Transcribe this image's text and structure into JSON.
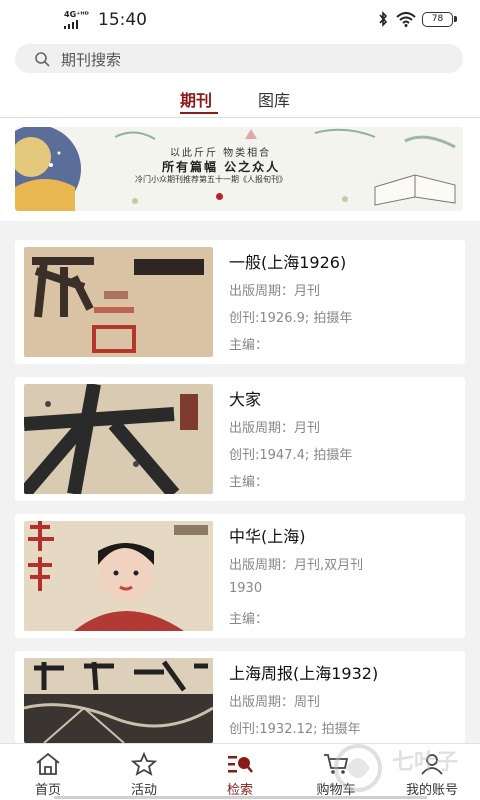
{
  "status_bar": {
    "network": "4G⁺ᴴᴰ",
    "time": "15:40",
    "battery": "78"
  },
  "search": {
    "placeholder": "期刊搜索"
  },
  "tabs": [
    {
      "label": "期刊",
      "active": true
    },
    {
      "label": "图库",
      "active": false
    }
  ],
  "banner": {
    "line1": "以此斤斤   物类相合",
    "line2": "所有篇幅   公之众人",
    "line3": "冷门小众期刊推荐第五十一期《人报旬刊》"
  },
  "magazines": [
    {
      "title": "一般(上海1926)",
      "period": "出版周期：月刊",
      "founded": "创刊:1926.9; 拍摄年",
      "editor": "主编："
    },
    {
      "title": "大家",
      "period": "出版周期：月刊",
      "founded": "创刊:1947.4; 拍摄年",
      "editor": "主编："
    },
    {
      "title": "中华(上海)",
      "period": "出版周期：月刊,双月刊",
      "founded": "1930",
      "editor": "主编："
    },
    {
      "title": "上海周报(上海1932)",
      "period": "出版周期：周刊",
      "founded": "创刊:1932.12; 拍摄年",
      "editor": ""
    }
  ],
  "bottom_nav": [
    {
      "label": "首页",
      "icon": "home-icon",
      "active": false
    },
    {
      "label": "活动",
      "icon": "star-icon",
      "active": false
    },
    {
      "label": "检索",
      "icon": "search-list-icon",
      "active": true
    },
    {
      "label": "购物车",
      "icon": "cart-icon",
      "active": false
    },
    {
      "label": "我的账号",
      "icon": "user-icon",
      "active": false
    }
  ],
  "watermark": "七叶子",
  "colors": {
    "accent": "#8b1a1a",
    "background": "#f2f2f2"
  }
}
